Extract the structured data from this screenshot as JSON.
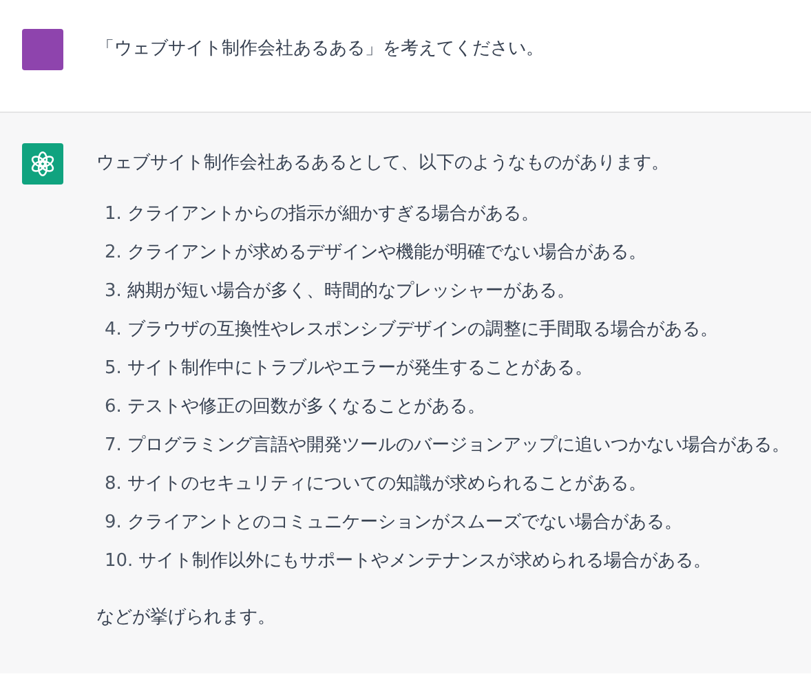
{
  "messages": [
    {
      "kind": "user",
      "text": "「ウェブサイト制作会社あるある」を考えてください。"
    },
    {
      "kind": "assistant",
      "intro": "ウェブサイト制作会社あるあるとして、以下のようなものがあります。",
      "items": [
        {
          "number": "1.",
          "text": "クライアントからの指示が細かすぎる場合がある。"
        },
        {
          "number": "2.",
          "text": "クライアントが求めるデザインや機能が明確でない場合がある。"
        },
        {
          "number": "3.",
          "text": "納期が短い場合が多く、時間的なプレッシャーがある。"
        },
        {
          "number": "4.",
          "text": "ブラウザの互換性やレスポンシブデザインの調整に手間取る場合がある。"
        },
        {
          "number": "5.",
          "text": "サイト制作中にトラブルやエラーが発生することがある。"
        },
        {
          "number": "6.",
          "text": "テストや修正の回数が多くなることがある。"
        },
        {
          "number": "7.",
          "text": "プログラミング言語や開発ツールのバージョンアップに追いつかない場合がある。"
        },
        {
          "number": "8.",
          "text": "サイトのセキュリティについての知識が求められることがある。"
        },
        {
          "number": "9.",
          "text": "クライアントとのコミュニケーションがスムーズでない場合がある。"
        },
        {
          "number": "10.",
          "text": "サイト制作以外にもサポートやメンテナンスが求められる場合がある。"
        }
      ],
      "outro": "などが挙げられます。"
    }
  ]
}
